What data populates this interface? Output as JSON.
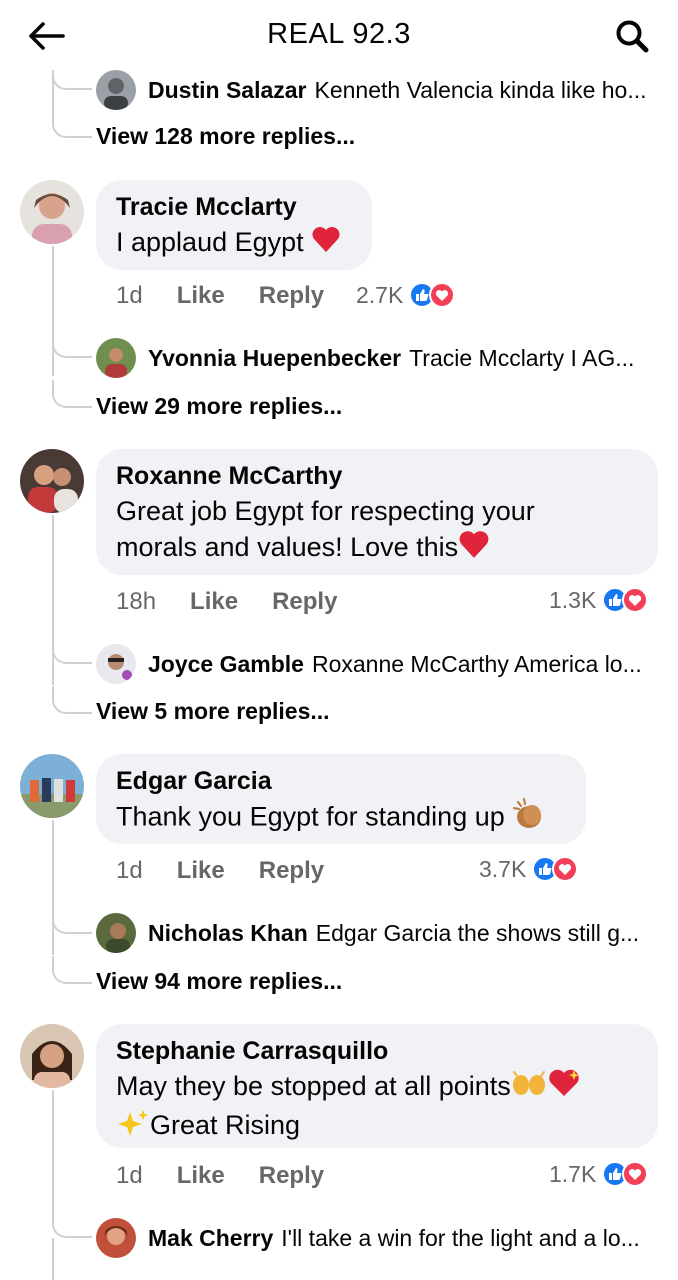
{
  "header": {
    "title": "REAL 92.3"
  },
  "top_thread": {
    "reply_name": "Dustin Salazar",
    "reply_text": "Kenneth Valencia kinda like ho...",
    "more": "View 128 more replies..."
  },
  "comments": [
    {
      "name": "Tracie Mcclarty",
      "text": "I applaud Egypt",
      "time": "1d",
      "like": "Like",
      "reply": "Reply",
      "reactions": "2.7K",
      "reply_name": "Yvonnia Huepenbecker",
      "reply_text": "Tracie Mcclarty I AG...",
      "more": "View 29 more replies..."
    },
    {
      "name": "Roxanne McCarthy",
      "text_line1": "Great job Egypt for respecting your",
      "text_line2": "morals and values! Love this",
      "time": "18h",
      "like": "Like",
      "reply": "Reply",
      "reactions": "1.3K",
      "reply_name": "Joyce Gamble",
      "reply_text": "Roxanne McCarthy America lo...",
      "more": "View 5 more replies..."
    },
    {
      "name": "Edgar Garcia",
      "text": "Thank you Egypt for standing up",
      "time": "1d",
      "like": "Like",
      "reply": "Reply",
      "reactions": "3.7K",
      "reply_name": "Nicholas Khan",
      "reply_text": "Edgar Garcia the shows still g...",
      "more": "View 94 more replies..."
    },
    {
      "name": "Stephanie Carrasquillo",
      "text_line1": "May they be stopped at all points",
      "text_line2": "Great Rising",
      "time": "1d",
      "like": "Like",
      "reply": "Reply",
      "reactions": "1.7K",
      "reply_name": "Mak Cherry",
      "reply_text": "I'll take a win for the light and a lo..."
    }
  ],
  "colors": {
    "like_blue": "#1877f2",
    "love_red": "#f33e58",
    "bubble_bg": "#f0f2f5",
    "muted": "#65676b"
  }
}
